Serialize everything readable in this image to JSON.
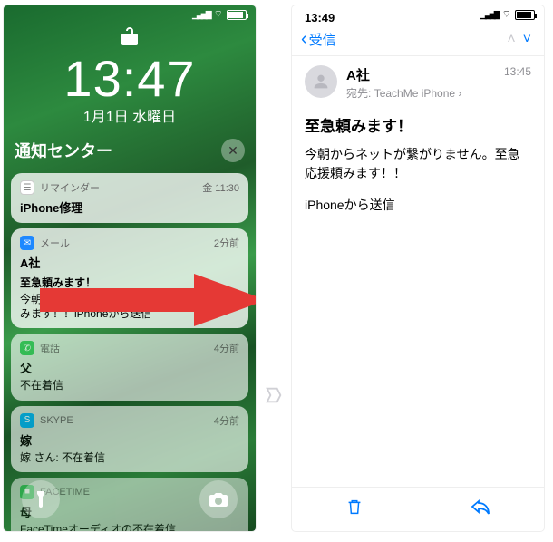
{
  "lock": {
    "time": "13:47",
    "date": "1月1日 水曜日",
    "nc_title": "通知センター",
    "cards": [
      {
        "app": "リマインダー",
        "time": "金 11:30",
        "title": "iPhone修理",
        "body": "",
        "iconColor": "#ffffff",
        "iconGlyph": "●"
      },
      {
        "app": "メール",
        "time": "2分前",
        "title": "A社",
        "subtitle": "至急頼みます！",
        "body": "今朝からネットが繋がりません。至急応援頼みます！！iPhoneから送信",
        "iconColor": "#1e88ff",
        "iconGlyph": "✉"
      },
      {
        "app": "電話",
        "time": "4分前",
        "title": "父",
        "body": "不在着信",
        "iconColor": "#34c759",
        "iconGlyph": "✆"
      },
      {
        "app": "SKYPE",
        "time": "4分前",
        "title": "嫁",
        "body": "嫁 さん: 不在着信",
        "iconColor": "#00aff0",
        "iconGlyph": "S"
      },
      {
        "app": "FACETIME",
        "time": "",
        "title": "母",
        "body": "FaceTimeオーディオの不在着信",
        "iconColor": "#34c759",
        "iconGlyph": "■"
      }
    ]
  },
  "mail": {
    "status_time": "13:49",
    "back_label": "受信",
    "sender": "A社",
    "recipient_prefix": "宛先:",
    "recipient_name": "TeachMe iPhone",
    "time": "13:45",
    "subject": "至急頼みます！",
    "body": "今朝からネットが繋がりません。至急応援頼みます！！",
    "signature": "iPhoneから送信"
  }
}
